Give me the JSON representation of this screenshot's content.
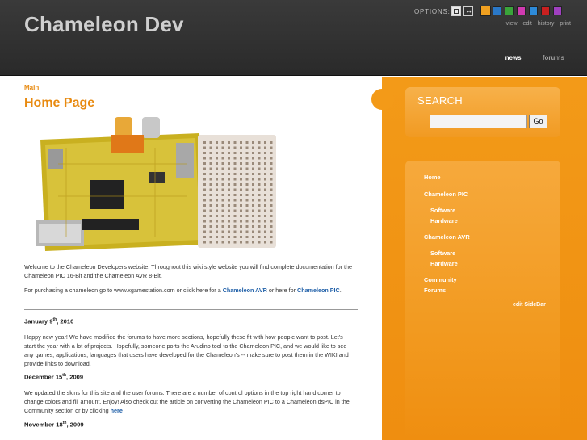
{
  "header": {
    "site_title": "Chameleon Dev",
    "options_label": "OPTIONS:",
    "width_fluid_symbol": "↔",
    "color_swatches": [
      "#f0a020",
      "#2a78c8",
      "#3aa43a",
      "#d03ab0",
      "#2d8ad8",
      "#c82020",
      "#a040c0"
    ],
    "page_actions": [
      "view",
      "edit",
      "history",
      "print"
    ],
    "nav": {
      "news": "news",
      "forums": "forums"
    }
  },
  "main": {
    "breadcrumb": "Main",
    "title": "Home Page",
    "intro": "Welcome to the Chameleon Developers website. Throughout this wiki style website you will find complete documentation for the Chameleon PIC 16-Bit and the Chameleon AVR 8-Bit.",
    "purchase_prefix": "For purchasing a chameleon go to www.xgamestation.com or click here for a",
    "purchase_avr_link": "Chameleon AVR",
    "purchase_middle": "or here for",
    "purchase_pic_link": "Chameleon PIC",
    "purchase_suffix": ".",
    "news": [
      {
        "date_month": "January 9",
        "date_suffix": "th",
        "date_year": ", 2010",
        "text": "Happy new year! We have modified the forums to have more sections, hopefully these fit with how people want to post. Let's start the year with a lot of projects. Hopefully, someone ports the Arudino tool to the Chameleon PIC, and we would like to see any games, applications, languages that users have developed for the Chameleon's -- make sure to post them in the WIKI and provide links to download."
      },
      {
        "date_month": "December 15",
        "date_suffix": "th",
        "date_year": ", 2009",
        "text": "We updated the skins for this site and the user forums. There are a number of control options in the top right hand corner to change colors and fill amount. Enjoy! Also check out the article on converting the Chameleon PIC to a Chameleon dsPIC in the Community section or by clicking",
        "link": "here"
      },
      {
        "date_month": "November 18",
        "date_suffix": "th",
        "date_year": ", 2009"
      }
    ]
  },
  "sidebar": {
    "search_title": "SEARCH",
    "search_value": "",
    "go_label": "Go",
    "links": {
      "home": "Home",
      "chameleon_pic": "Chameleon PIC",
      "pic_software": "Software",
      "pic_hardware": "Hardware",
      "chameleon_avr": "Chameleon AVR",
      "avr_software": "Software",
      "avr_hardware": "Hardware",
      "community": "Community",
      "forums": "Forums"
    },
    "edit_sidebar": "edit SideBar"
  }
}
